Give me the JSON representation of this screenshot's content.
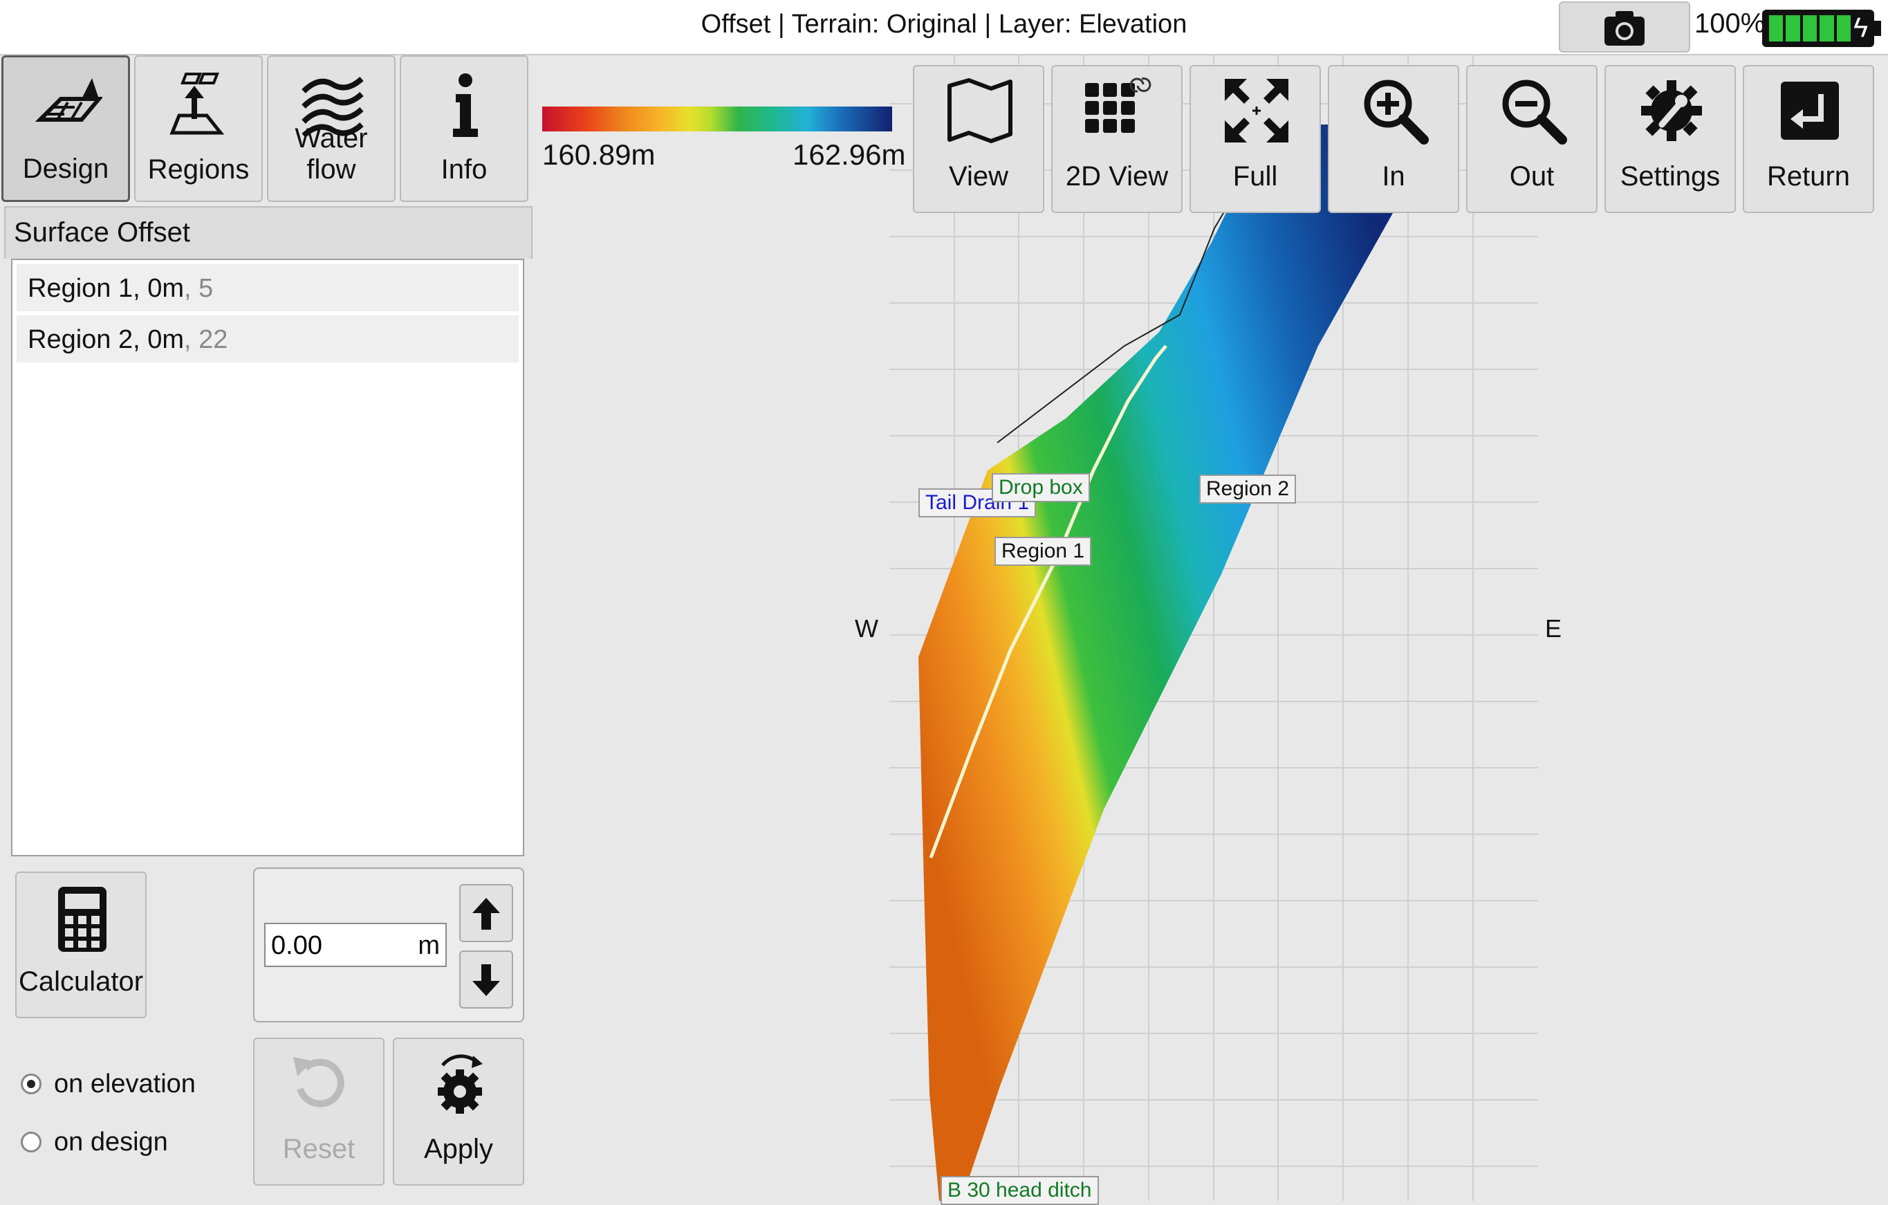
{
  "titlebar": {
    "title": "Offset | Terrain: Original | Layer: Elevation",
    "battery_pct": "100%"
  },
  "tabs": [
    {
      "label": "Design",
      "icon": "design-icon",
      "active": true
    },
    {
      "label": "Regions",
      "icon": "regions-icon",
      "active": false
    },
    {
      "label": "Water flow",
      "icon": "water-flow-icon",
      "active": false
    },
    {
      "label": "Info",
      "icon": "info-icon",
      "active": false
    }
  ],
  "panel": {
    "header": "Surface Offset",
    "items": [
      {
        "name": "Region 1, 0m",
        "count": ", 5"
      },
      {
        "name": "Region 2, 0m",
        "count": ", 22"
      }
    ]
  },
  "controls": {
    "calculator_label": "Calculator",
    "offset_value": "0.00",
    "offset_unit": "m",
    "radio_elevation": "on elevation",
    "radio_design": "on design",
    "selected_radio": "on elevation",
    "reset_label": "Reset",
    "apply_label": "Apply"
  },
  "scale": {
    "min": "160.89m",
    "max": "162.96m",
    "colors": [
      "#c8102e",
      "#f08a1e",
      "#e7e02a",
      "#2fb44a",
      "#22b0d8",
      "#13206e"
    ]
  },
  "map": {
    "labels": {
      "tail_drain": "Tail Drain 1",
      "drop_box": "Drop box",
      "region1": "Region 1",
      "region2": "Region 2",
      "head_ditch": "B 30 head ditch"
    },
    "compass_w": "W",
    "compass_e": "E"
  },
  "toolbar": [
    {
      "label": "View",
      "icon": "map-icon"
    },
    {
      "label": "2D View",
      "icon": "grid-icon"
    },
    {
      "label": "Full",
      "icon": "fullscreen-icon"
    },
    {
      "label": "In",
      "icon": "zoom-in-icon"
    },
    {
      "label": "Out",
      "icon": "zoom-out-icon"
    },
    {
      "label": "Settings",
      "icon": "settings-icon"
    },
    {
      "label": "Return",
      "icon": "return-icon"
    }
  ]
}
